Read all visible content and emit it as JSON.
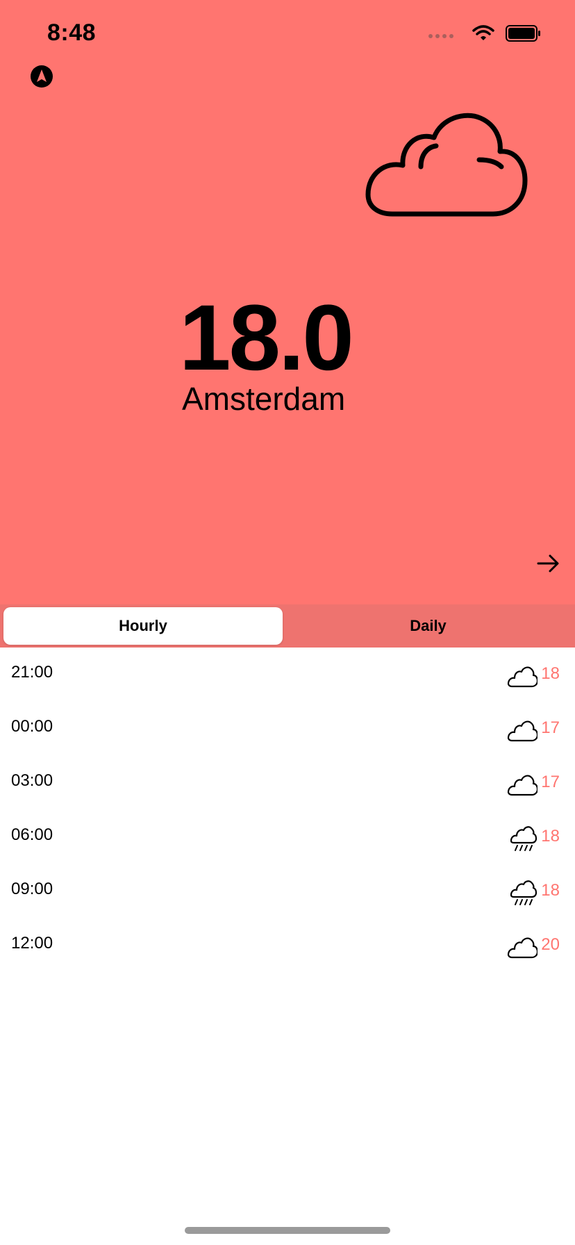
{
  "status_bar": {
    "time": "8:48",
    "icons": [
      "signal-dots-icon",
      "wifi-icon",
      "battery-icon"
    ]
  },
  "current": {
    "temperature": "18.0",
    "city": "Amsterdam",
    "condition_icon": "cloud-icon"
  },
  "tabs": {
    "hourly_label": "Hourly",
    "daily_label": "Daily",
    "selected": "Hourly"
  },
  "hourly": [
    {
      "time": "21:00",
      "icon": "cloud-icon",
      "temp": "18"
    },
    {
      "time": "00:00",
      "icon": "cloud-icon",
      "temp": "17"
    },
    {
      "time": "03:00",
      "icon": "cloud-icon",
      "temp": "17"
    },
    {
      "time": "06:00",
      "icon": "cloud-rain-icon",
      "temp": "18"
    },
    {
      "time": "09:00",
      "icon": "cloud-rain-icon",
      "temp": "18"
    },
    {
      "time": "12:00",
      "icon": "cloud-icon",
      "temp": "20"
    }
  ],
  "colors": {
    "accent": "#FF7570",
    "segmented_bg": "#EE736F"
  }
}
